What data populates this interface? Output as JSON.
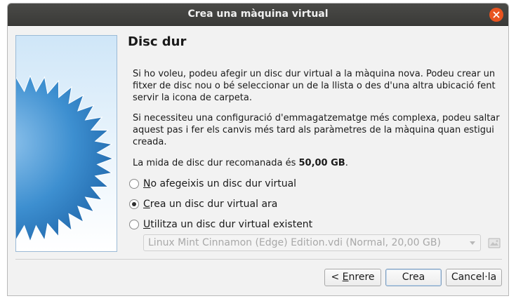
{
  "window": {
    "title": "Crea una màquina virtual"
  },
  "page": {
    "heading": "Disc dur",
    "para1": "Si ho voleu, podeu afegir un disc dur virtual a la màquina nova. Podeu crear un fitxer de disc nou o bé seleccionar un de la llista o des d'una altra ubicació fent servir la icona de carpeta.",
    "para2": "Si necessiteu una configuració d'emmagatzematge més complexa, podeu saltar aquest pas i fer els canvis més tard als paràmetres de la màquina quan estigui creada.",
    "recommended_prefix": "La mida de disc dur recomanada és ",
    "recommended_size": "50,00 GB",
    "recommended_suffix": "."
  },
  "options": [
    {
      "mnemonic": "N",
      "rest": "o afegeixis un disc dur virtual",
      "selected": false
    },
    {
      "mnemonic": "C",
      "rest": "rea un disc dur virtual ara",
      "selected": true
    },
    {
      "mnemonic": "U",
      "rest": "tilitza un disc dur virtual existent",
      "selected": false
    }
  ],
  "disk_select": {
    "value": "Linux Mint Cinnamon (Edge) Edition.vdi (Normal, 20,00 GB)",
    "enabled": false
  },
  "buttons": {
    "back_prefix": "< ",
    "back_mnemonic": "E",
    "back_rest": "nrere",
    "create": "Crea",
    "cancel": "Cancel·la"
  },
  "colors": {
    "accent": "#e95420",
    "titlebar": "#3c3c3a",
    "banner_star": "#1f6fb2"
  }
}
